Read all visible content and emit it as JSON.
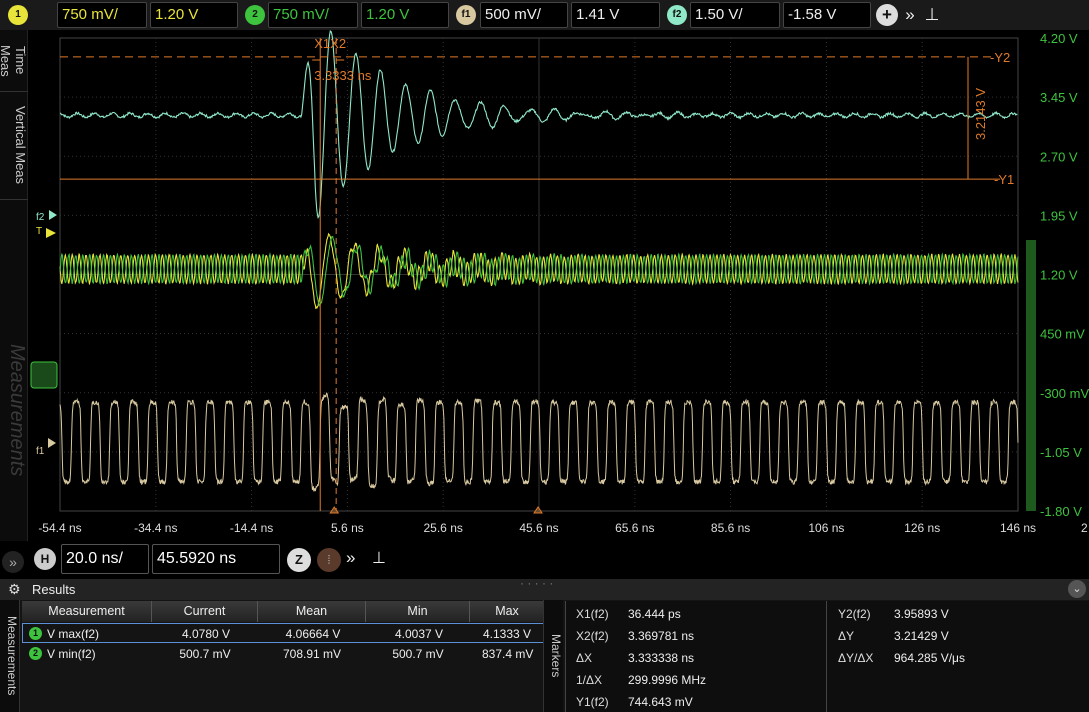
{
  "channels": [
    {
      "id": "1",
      "scale": "750 mV/",
      "offset": "1.20 V",
      "color": "#e8e43a"
    },
    {
      "id": "2",
      "scale": "750 mV/",
      "offset": "1.20 V",
      "color": "#3ec33e"
    },
    {
      "id": "f1",
      "scale": "500 mV/",
      "offset": "1.41 V",
      "color": "#d8c9a0"
    },
    {
      "id": "f2",
      "scale": "1.50 V/",
      "offset": "-1.58 V",
      "color": "#8fe8c8"
    }
  ],
  "left_tabs": [
    "Time Meas",
    "Vertical Meas"
  ],
  "watermark": "Measurements",
  "chart_data": {
    "type": "line",
    "x_ticks": [
      "-54.4 ns",
      "-34.4 ns",
      "-14.4 ns",
      "5.6 ns",
      "25.6 ns",
      "45.6 ns",
      "65.6 ns",
      "85.6 ns",
      "106 ns",
      "126 ns",
      "146 ns"
    ],
    "x_extra": "2",
    "y_ticks_right": [
      "4.20 V",
      "3.45 V",
      "2.70 V",
      "1.95 V",
      "1.20 V",
      "450 mV",
      "-300 mV",
      "-1.05 V",
      "-1.80 V"
    ],
    "xlim_ns": [
      -54.4,
      146
    ],
    "grid": true,
    "markers": {
      "x1_label": "X1",
      "x2_label": "X2",
      "dx_label": "3.3333 ns",
      "y1_label": "Y1",
      "y2_label": "Y2",
      "dy_label": "3.2143 V",
      "x1_ns": 0.036,
      "x2_ns": 3.37,
      "y1_v": 2.41,
      "y2_v": 3.96
    },
    "channel_labels": [
      "f2",
      "T",
      "f1"
    ],
    "series": [
      {
        "channel": "f2",
        "color": "#8fe8c8"
      },
      {
        "channel": "1",
        "color": "#e8e43a"
      },
      {
        "channel": "2",
        "color": "#3ec33e"
      },
      {
        "channel": "f1",
        "color": "#d8c9a0"
      }
    ]
  },
  "timebase": {
    "badge": "H",
    "scale": "20.0 ns/",
    "position": "45.5920 ns"
  },
  "results": {
    "title": "Results",
    "side_tab": "Measurements",
    "markers_tab": "Markers",
    "columns": [
      "Measurement",
      "Current",
      "Mean",
      "Min",
      "Max"
    ],
    "rows": [
      {
        "badge": "1",
        "name": "V max(f2)",
        "current": "4.0780 V",
        "mean": "4.06664 V",
        "min": "4.0037 V",
        "max": "4.1333 V"
      },
      {
        "badge": "2",
        "name": "V min(f2)",
        "current": "500.7 mV",
        "mean": "708.91 mV",
        "min": "500.7 mV",
        "max": "837.4 mV"
      }
    ],
    "markers_left": [
      {
        "label": "X1(f2)",
        "value": "36.444 ps"
      },
      {
        "label": "X2(f2)",
        "value": "3.369781 ns"
      },
      {
        "label": "ΔX",
        "value": "3.333338 ns"
      },
      {
        "label": "1/ΔX",
        "value": "299.9996 MHz"
      },
      {
        "label": "Y1(f2)",
        "value": "744.643 mV"
      }
    ],
    "markers_right": [
      {
        "label": "Y2(f2)",
        "value": "3.95893 V"
      },
      {
        "label": "ΔY",
        "value": "3.21429 V"
      },
      {
        "label": "ΔY/ΔX",
        "value": "964.285 V/μs"
      }
    ]
  }
}
